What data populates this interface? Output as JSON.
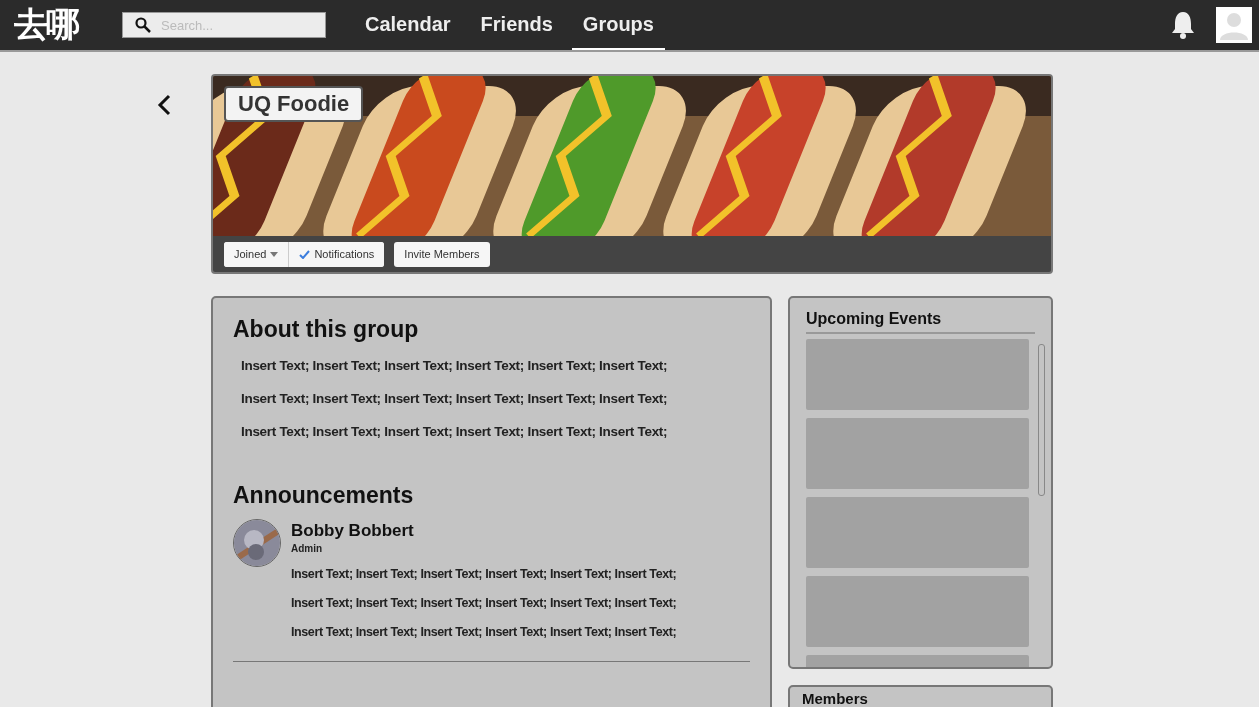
{
  "topbar": {
    "logo": "去哪",
    "search": {
      "placeholder": "Search..."
    },
    "tabs": [
      {
        "label": "Calendar",
        "selected": false
      },
      {
        "label": "Friends",
        "selected": false
      },
      {
        "label": "Groups",
        "selected": true
      }
    ]
  },
  "group": {
    "name": "UQ Foodie",
    "actions": [
      {
        "kind": "dropdown",
        "label": "Joined"
      },
      {
        "kind": "toggle",
        "label": "Notifications",
        "checked": true
      },
      {
        "kind": "button",
        "label": "Invite Members"
      }
    ]
  },
  "about": {
    "title": "About this group",
    "lines": [
      "Insert Text; Insert Text; Insert Text; Insert Text; Insert Text; Insert Text;",
      "Insert Text; Insert Text; Insert Text; Insert Text; Insert Text; Insert Text;",
      "Insert Text; Insert Text; Insert Text; Insert Text; Insert Text; Insert Text;"
    ]
  },
  "announcements": {
    "title": "Announcements",
    "posts": [
      {
        "author": "Bobby Bobbert",
        "role": "Admin",
        "lines": [
          "Insert Text; Insert Text; Insert Text; Insert Text; Insert Text; Insert Text;",
          "Insert Text; Insert Text; Insert Text; Insert Text; Insert Text; Insert Text;",
          "Insert Text; Insert Text; Insert Text; Insert Text; Insert Text; Insert Text;"
        ]
      }
    ]
  },
  "upcoming_events": {
    "title": "Upcoming Events"
  },
  "members": {
    "title": "Members"
  }
}
